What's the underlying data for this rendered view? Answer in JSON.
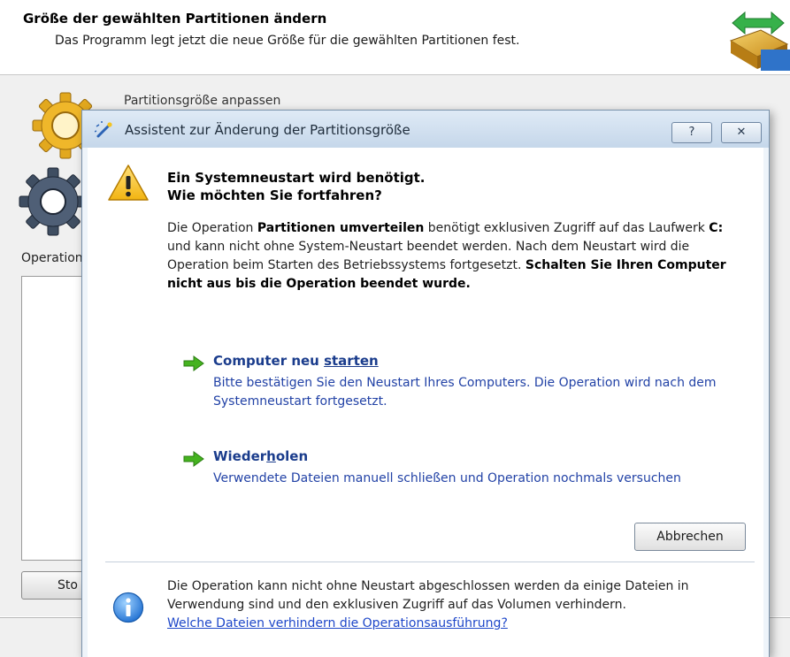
{
  "wizard": {
    "title": "Größe der gewählten Partitionen ändern",
    "subtitle": "Das Programm legt jetzt die neue Größe für die gewählten Partitionen fest.",
    "step_label": "Partitionsgröße anpassen",
    "operations_label": "Operation",
    "stop_button": "Sto"
  },
  "dialog": {
    "title": "Assistent zur Änderung der Partitionsgröße",
    "help_button": "?",
    "close_button": "✕",
    "heading_line1": "Ein Systemneustart wird benötigt.",
    "heading_line2": "Wie möchten Sie fortfahren?",
    "message": {
      "part1": "Die Operation ",
      "op_name": "Partitionen umverteilen",
      "part2": " benötigt exklusiven Zugriff auf das Laufwerk ",
      "drive": "C:",
      "part3": " und kann nicht ohne System-Neustart beendet werden. Nach dem Neustart wird die Operation beim Starten des Betriebssystems fortgesetzt. ",
      "warning": "Schalten Sie Ihren Computer nicht aus bis die Operation beendet wurde."
    },
    "actions": [
      {
        "title": "Computer neu starten",
        "description": "Bitte bestätigen Sie den Neustart Ihres Computers. Die Operation wird nach dem Systemneustart fortgesetzt."
      },
      {
        "title": "Wiederholen",
        "description": "Verwendete Dateien manuell schließen und Operation nochmals versuchen"
      }
    ],
    "cancel_button": "Abbrechen",
    "info_text": "Die Operation kann nicht ohne Neustart abgeschlossen werden da einige Dateien in Verwendung sind und den exklusiven Zugriff auf das Volumen verhindern.",
    "info_link": "Welche Dateien verhindern die Operationsausführung?"
  },
  "icons": {
    "logo": "partition-resize-logo-icon",
    "gear_gold": "gold-gear-icon",
    "gear_blue": "blue-gear-icon",
    "dialog_title": "wizard-wand-icon",
    "warning": "warning-triangle-icon",
    "action_arrow": "green-arrow-icon",
    "info": "info-icon"
  },
  "colors": {
    "link": "#1e47c9",
    "action_title": "#1a3c8c",
    "dialog_titlebar": "#c5d7ea",
    "warning_yellow": "#f6c21b",
    "arrow_green": "#45b31f"
  }
}
